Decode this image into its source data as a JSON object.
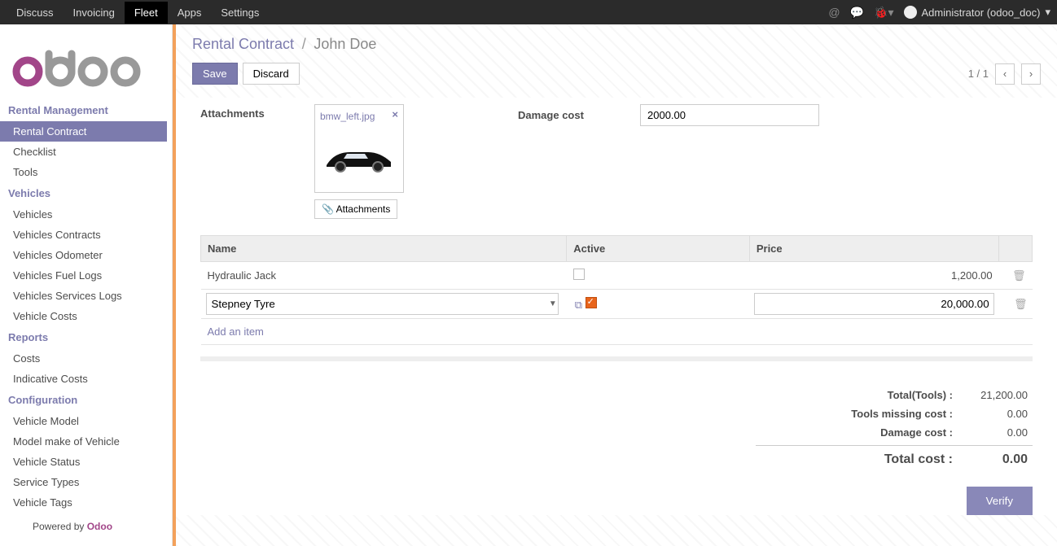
{
  "topmenu": {
    "items": [
      "Discuss",
      "Invoicing",
      "Fleet",
      "Apps",
      "Settings"
    ],
    "active": "Fleet",
    "user": "Administrator (odoo_doc)"
  },
  "sidebar": {
    "sections": [
      {
        "title": "Rental Management",
        "items": [
          {
            "label": "Rental Contract",
            "active": true
          },
          {
            "label": "Checklist"
          },
          {
            "label": "Tools"
          }
        ]
      },
      {
        "title": "Vehicles",
        "items": [
          {
            "label": "Vehicles"
          },
          {
            "label": "Vehicles Contracts"
          },
          {
            "label": "Vehicles Odometer"
          },
          {
            "label": "Vehicles Fuel Logs"
          },
          {
            "label": "Vehicles Services Logs"
          },
          {
            "label": "Vehicle Costs"
          }
        ]
      },
      {
        "title": "Reports",
        "items": [
          {
            "label": "Costs"
          },
          {
            "label": "Indicative Costs"
          }
        ]
      },
      {
        "title": "Configuration",
        "items": [
          {
            "label": "Vehicle Model"
          },
          {
            "label": "Model make of Vehicle"
          },
          {
            "label": "Vehicle Status"
          },
          {
            "label": "Service Types"
          },
          {
            "label": "Vehicle Tags"
          }
        ]
      }
    ],
    "powered": "Powered by ",
    "powered_brand": "Odoo"
  },
  "breadcrumb": {
    "root": "Rental Contract",
    "current": "John Doe"
  },
  "buttons": {
    "save": "Save",
    "discard": "Discard",
    "verify": "Verify",
    "attachments": "Attachments",
    "add_item": "Add an item"
  },
  "pager": {
    "text": "1 / 1"
  },
  "labels": {
    "attachments": "Attachments",
    "damage_cost": "Damage cost",
    "col_name": "Name",
    "col_active": "Active",
    "col_price": "Price"
  },
  "attachment": {
    "file": "bmw_left.jpg"
  },
  "damage_cost": "2000.00",
  "rows": [
    {
      "name": "Hydraulic Jack",
      "active": false,
      "price": "1,200.00"
    },
    {
      "name": "Stepney Tyre",
      "active": true,
      "price": "20,000.00",
      "editing": true
    }
  ],
  "totals": {
    "tools_label": "Total(Tools) :",
    "tools": "21,200.00",
    "missing_label": "Tools missing cost :",
    "missing": "0.00",
    "damage_label": "Damage cost :",
    "damage": "0.00",
    "total_label": "Total cost :",
    "total": "0.00"
  }
}
